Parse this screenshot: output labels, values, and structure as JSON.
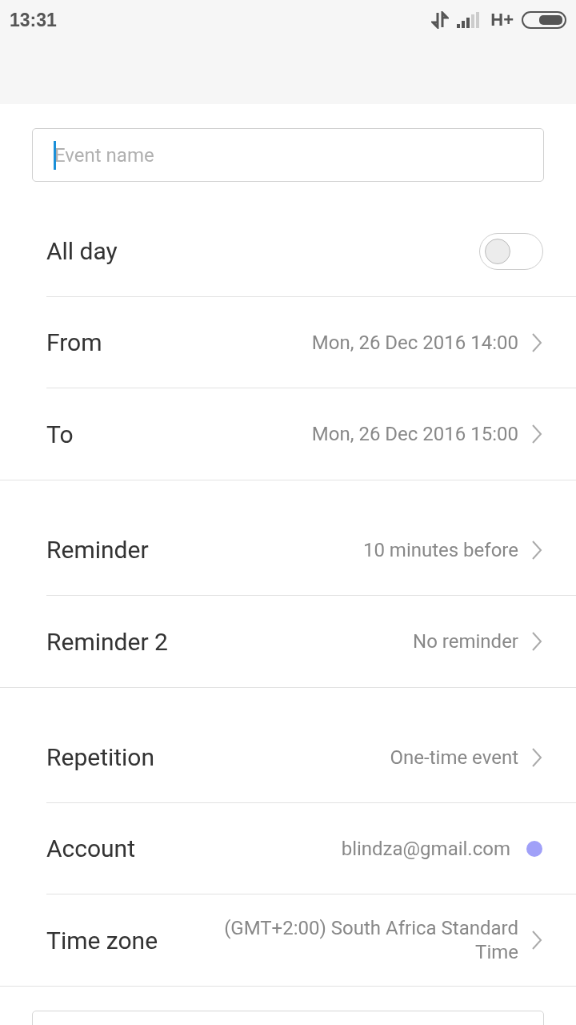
{
  "status_bar": {
    "time": "13:31",
    "network": "H+"
  },
  "event_name": {
    "placeholder": "Event name",
    "focused": true
  },
  "groups": [
    {
      "items": [
        {
          "kind": "toggle",
          "label": "All day",
          "on": false
        },
        {
          "kind": "link",
          "label": "From",
          "value": "Mon, 26 Dec 2016 14:00"
        },
        {
          "kind": "link",
          "label": "To",
          "value": "Mon, 26 Dec 2016 15:00"
        }
      ]
    },
    {
      "items": [
        {
          "kind": "link",
          "label": "Reminder",
          "value": "10 minutes before"
        },
        {
          "kind": "link",
          "label": "Reminder 2",
          "value": "No reminder"
        }
      ]
    },
    {
      "items": [
        {
          "kind": "link",
          "label": "Repetition",
          "value": "One-time event"
        },
        {
          "kind": "account",
          "label": "Account",
          "value": "blindza@gmail.com",
          "color": "#a0a0f8"
        },
        {
          "kind": "link",
          "label": "Time zone",
          "value": "(GMT+2:00) South Africa Standard Time"
        }
      ]
    }
  ]
}
